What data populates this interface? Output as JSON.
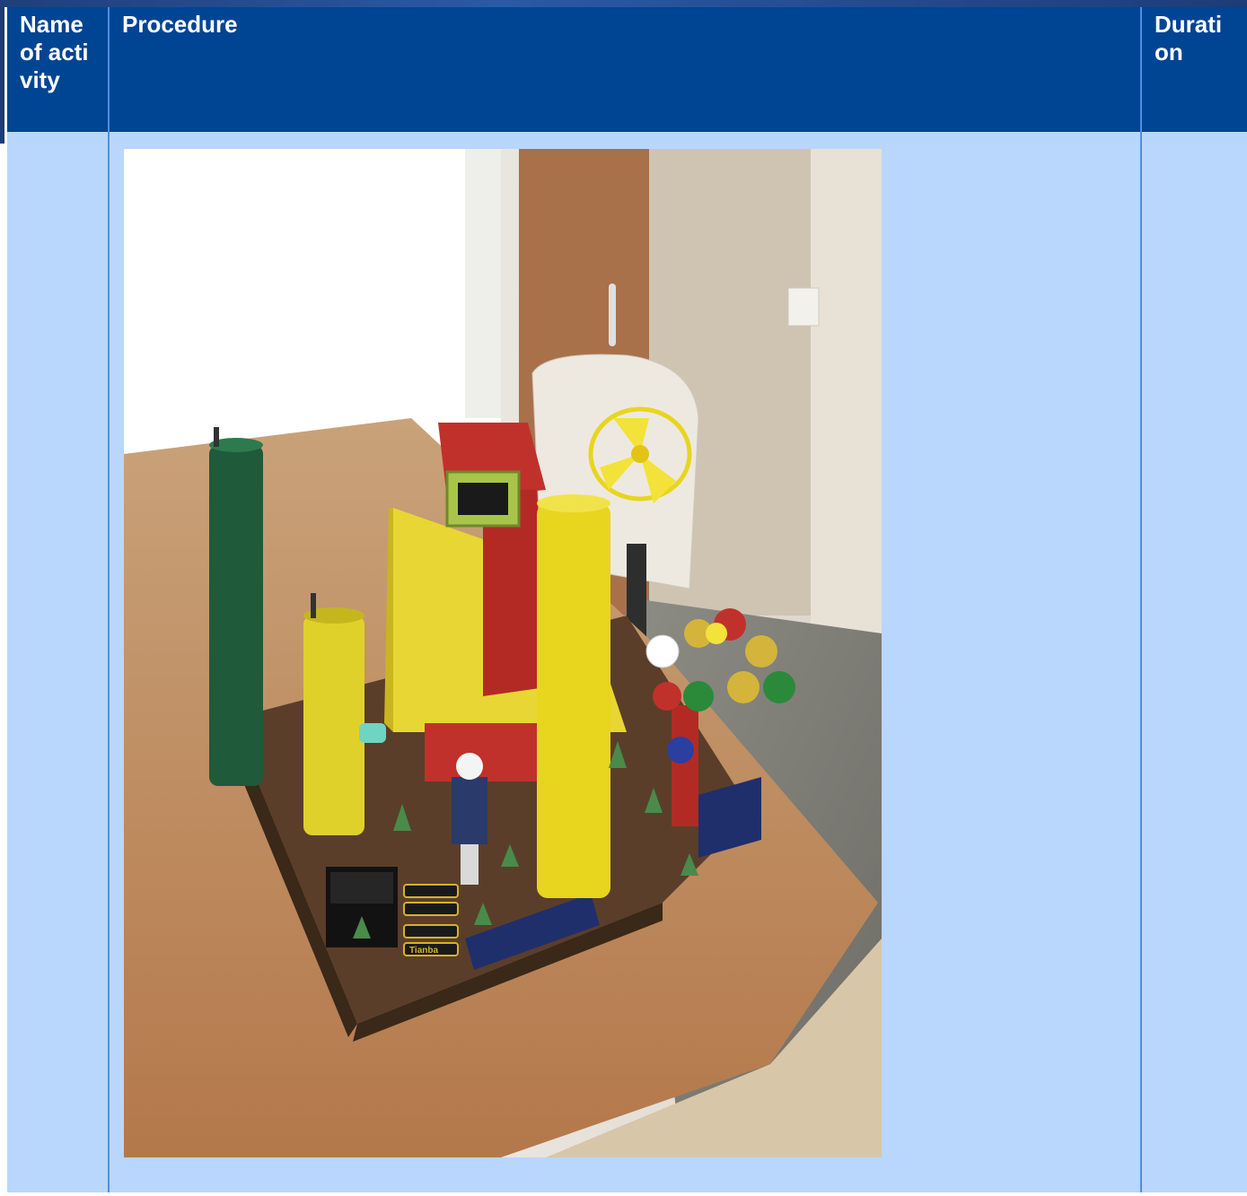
{
  "table": {
    "headers": {
      "name": "Name of activity",
      "procedure": "Procedure",
      "duration": "Duration"
    },
    "row": {
      "name": "",
      "duration": "",
      "photo": {
        "description_icon": "model-house-photo",
        "battery_text": "Tianba"
      }
    }
  },
  "colors": {
    "header_bg": "#004494",
    "header_text": "#ffffff",
    "cell_bg": "#b9d6fc",
    "border": "#4a90e2"
  }
}
